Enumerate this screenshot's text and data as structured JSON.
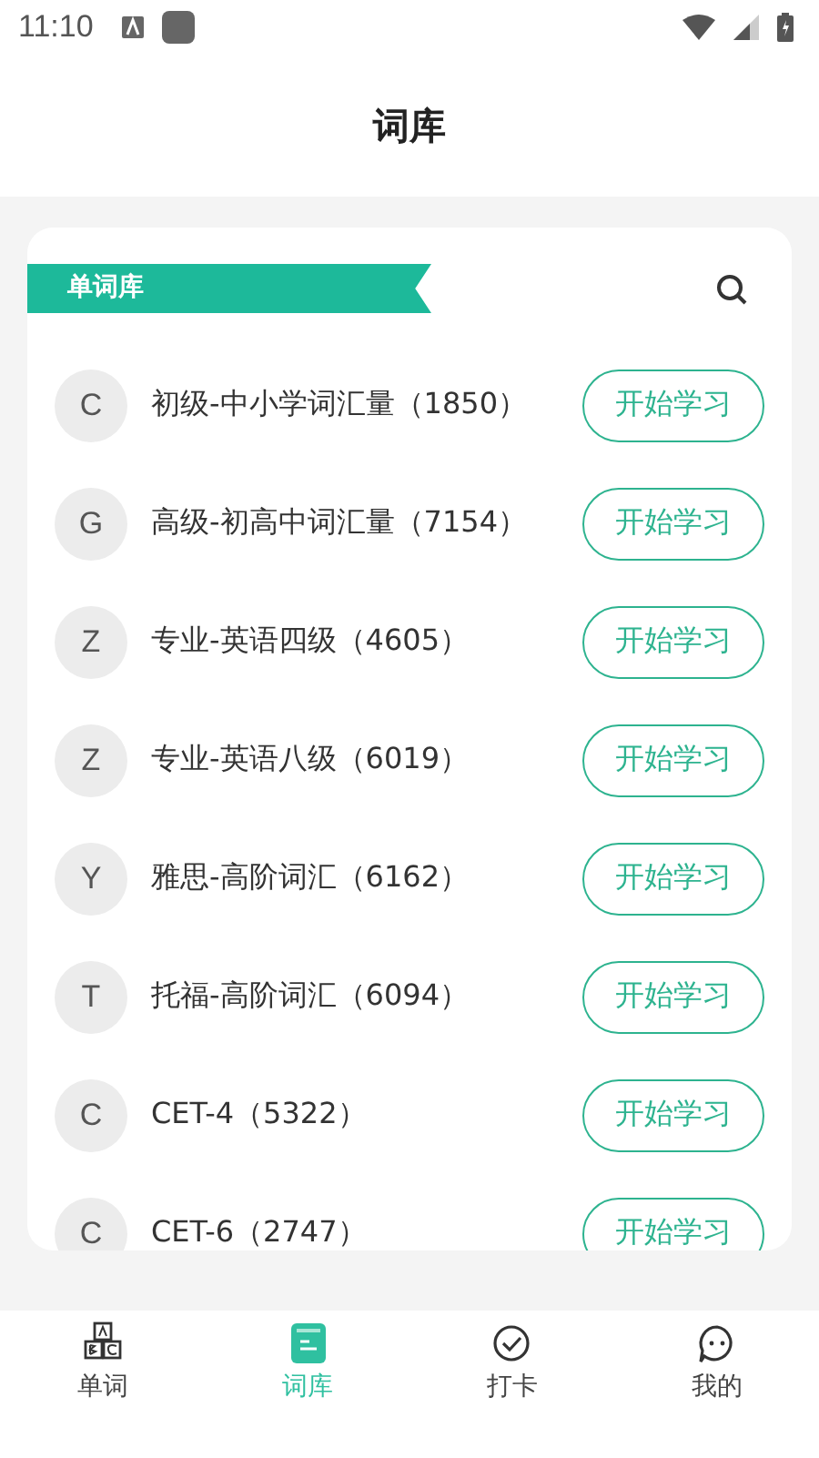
{
  "status_bar": {
    "time": "11:10"
  },
  "header": {
    "title": "词库"
  },
  "section": {
    "title": "单词库"
  },
  "books": [
    {
      "initial": "C",
      "name": "初级-中小学词汇量（1850）",
      "action": "开始学习"
    },
    {
      "initial": "G",
      "name": "高级-初高中词汇量（7154）",
      "action": "开始学习"
    },
    {
      "initial": "Z",
      "name": "专业-英语四级（4605）",
      "action": "开始学习"
    },
    {
      "initial": "Z",
      "name": "专业-英语八级（6019）",
      "action": "开始学习"
    },
    {
      "initial": "Y",
      "name": "雅思-高阶词汇（6162）",
      "action": "开始学习"
    },
    {
      "initial": "T",
      "name": "托福-高阶词汇（6094）",
      "action": "开始学习"
    },
    {
      "initial": "C",
      "name": "CET-4（5322）",
      "action": "开始学习"
    },
    {
      "initial": "C",
      "name": "CET-6（2747）",
      "action": "开始学习"
    }
  ],
  "tabs": [
    {
      "kind": "abc",
      "label": "单词",
      "selected": false
    },
    {
      "kind": "book",
      "label": "词库",
      "selected": true
    },
    {
      "kind": "check",
      "label": "打卡",
      "selected": false
    },
    {
      "kind": "chat",
      "label": "我的",
      "selected": false
    }
  ]
}
